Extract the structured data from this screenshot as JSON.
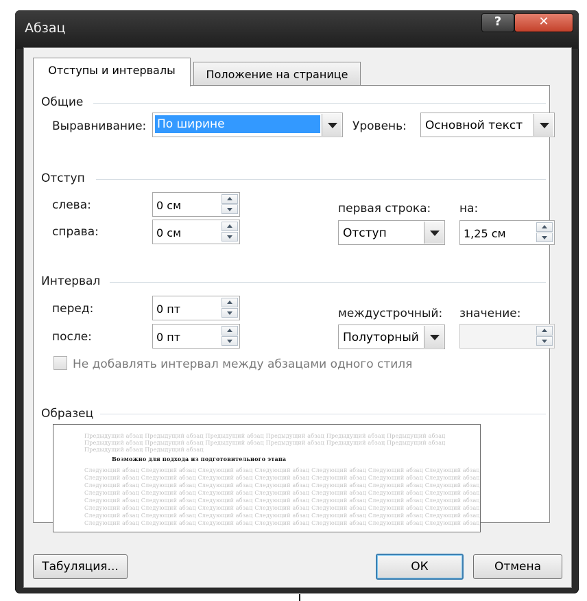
{
  "window": {
    "title": "Абзац",
    "help_label": "?",
    "close_label": "✕"
  },
  "tabs": [
    {
      "label": "Отступы и интервалы",
      "active": true
    },
    {
      "label": "Положение на странице",
      "active": false
    }
  ],
  "general": {
    "title": "Общие",
    "alignment_label": "Выравнивание:",
    "alignment_value": "По ширине",
    "level_label": "Уровень:",
    "level_value": "Основной текст"
  },
  "indent": {
    "title": "Отступ",
    "left_label": "слева:",
    "left_value": "0 см",
    "right_label": "справа:",
    "right_value": "0 см",
    "first_line_label": "первая строка:",
    "first_line_value": "Отступ",
    "by_label": "на:",
    "by_value": "1,25 см"
  },
  "spacing": {
    "title": "Интервал",
    "before_label": "перед:",
    "before_value": "0 пт",
    "after_label": "после:",
    "after_value": "0 пт",
    "line_spacing_label": "междустрочный:",
    "line_spacing_value": "Полуторный",
    "value_label": "значение:",
    "value_value": "",
    "no_space_label": "Не добавлять интервал между абзацами одного стиля",
    "no_space_checked": false
  },
  "preview": {
    "title": "Образец",
    "previous_line": "Предыдущий абзац Предыдущий абзац Предыдущий абзац Предыдущий абзац Предыдущий абзац Предыдущий абзац",
    "previous_line_short": "Предыдущий абзац Предыдущий абзац",
    "current_line": "Возможно для подхода из подготовительного этапа",
    "next_line": "Следующий абзац Следующий абзац Следующий абзац Следующий абзац Следующий абзац Следующий абзац Следующий абзац"
  },
  "buttons": {
    "tabs_label": "Табуляция...",
    "ok_label": "ОК",
    "cancel_label": "Отмена"
  },
  "colors": {
    "selection": "#3399ff",
    "title_bar": "#2b2b2b",
    "close_button": "#c4412b",
    "default_button_border": "#3c7fb1"
  }
}
